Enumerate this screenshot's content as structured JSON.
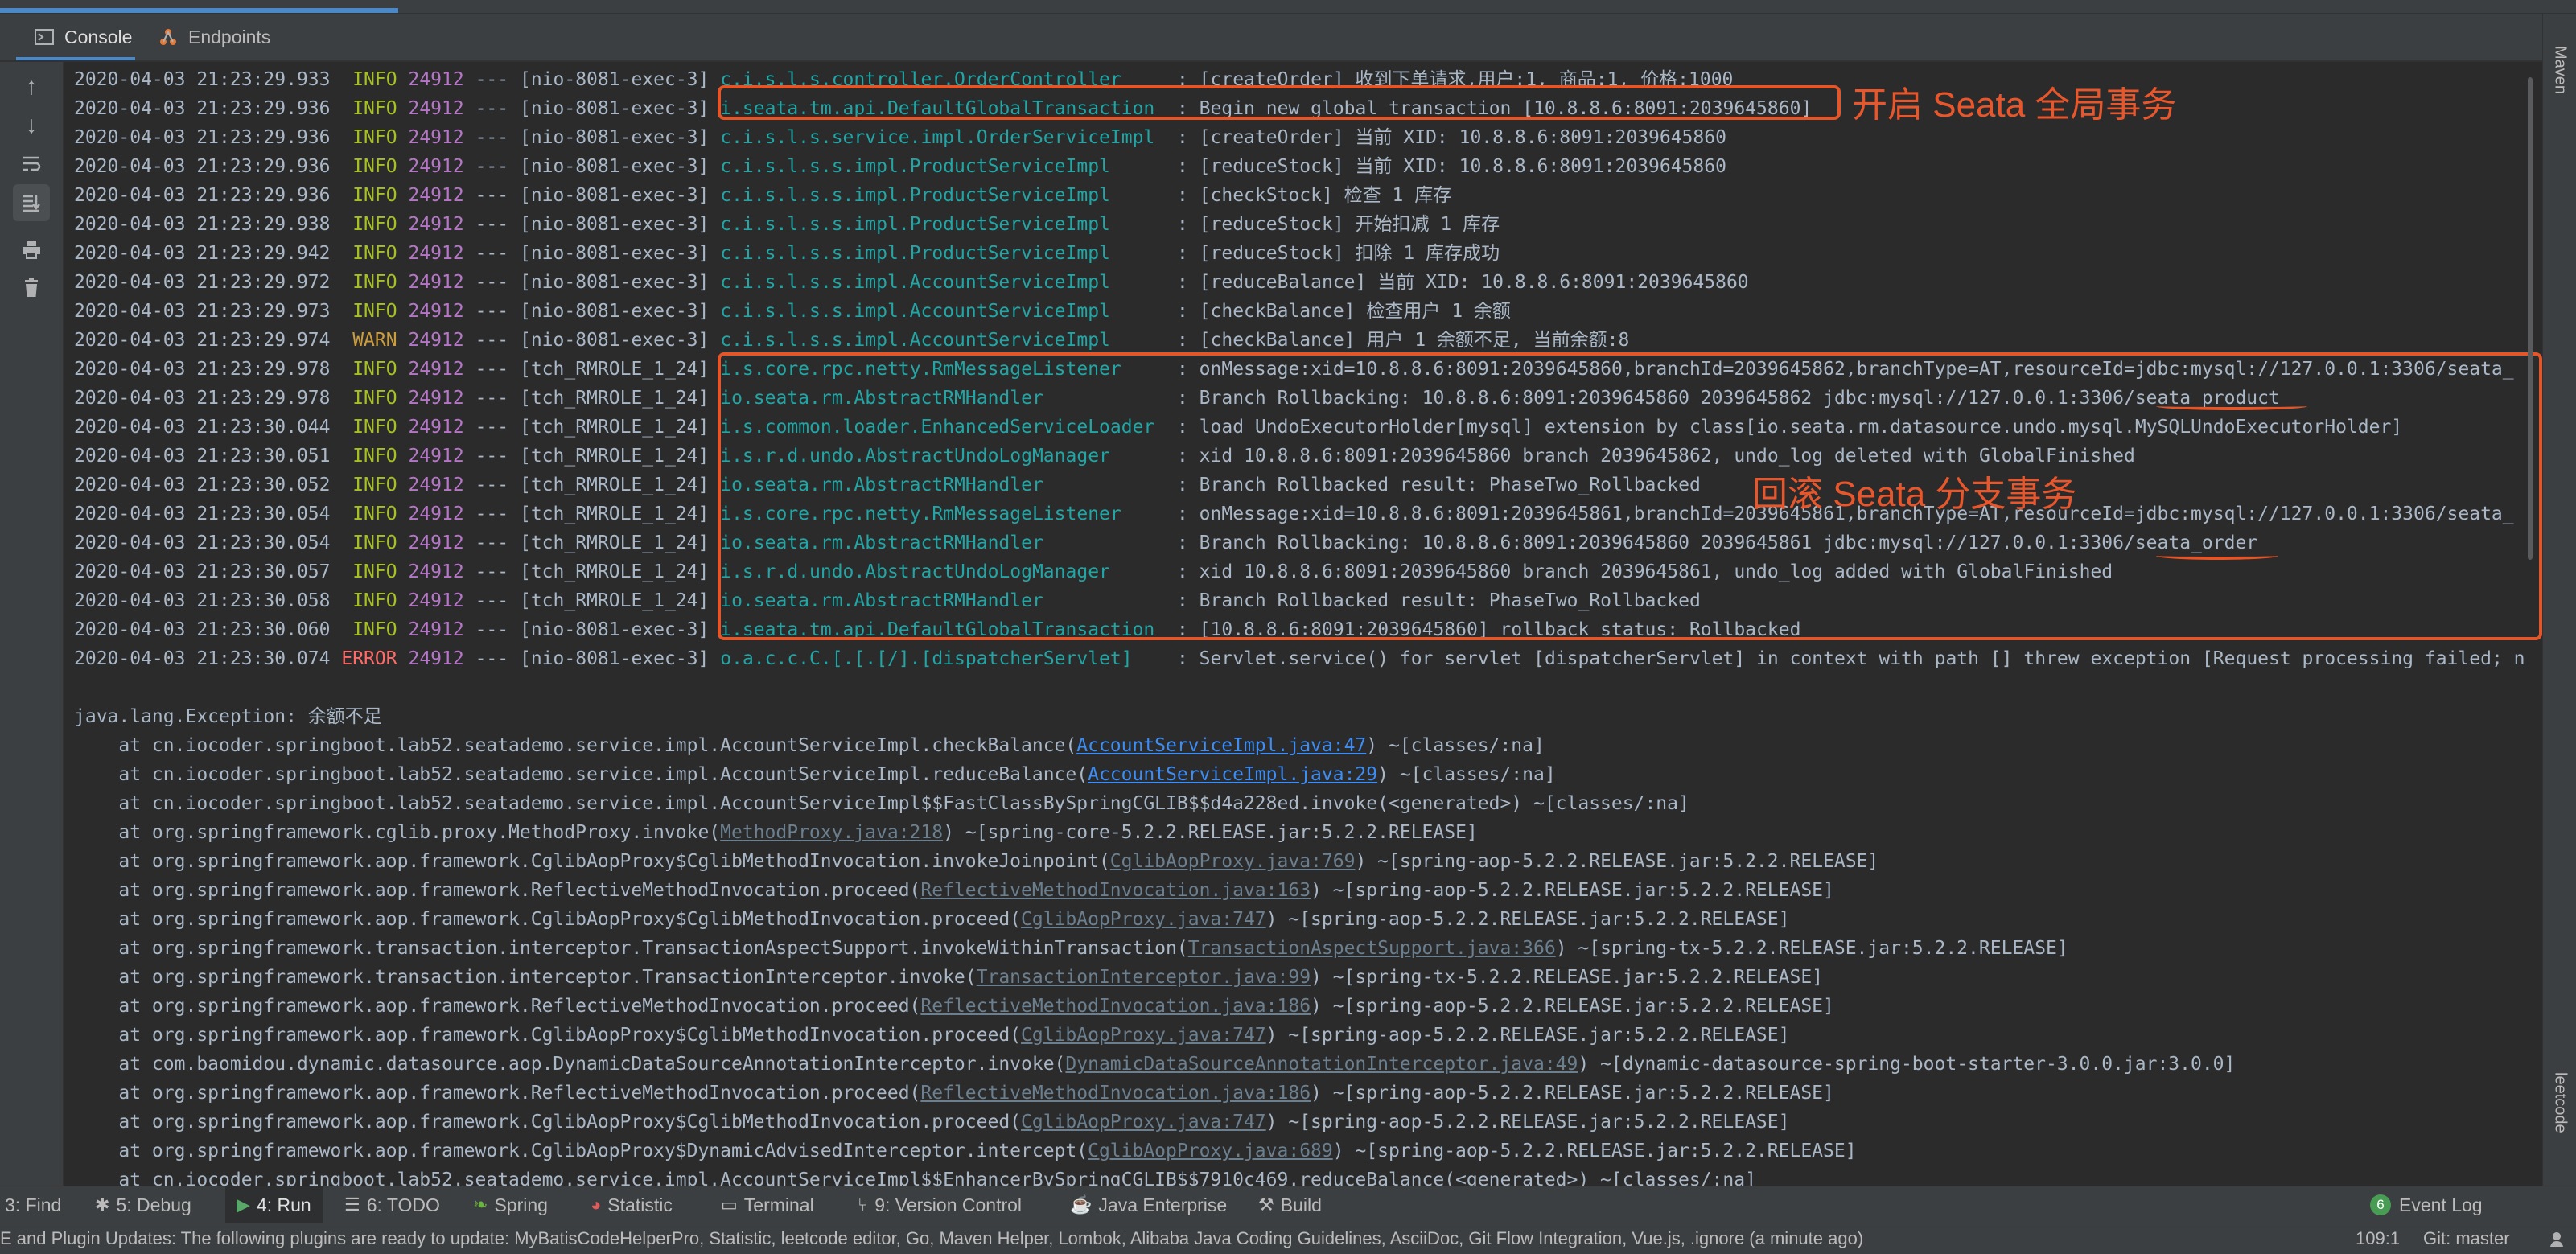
{
  "tabs": [
    {
      "label": "Console",
      "icon": "console-icon"
    },
    {
      "label": "Endpoints",
      "icon": "endpoints-icon"
    }
  ],
  "right_strip": {
    "maven": "Maven",
    "leetcode": "leetcode"
  },
  "log_lines": [
    {
      "time": "2020-04-03 21:23:29.933",
      "level": "INFO",
      "pid": "24912",
      "sep": "---",
      "thread": "[nio-8081-exec-3]",
      "logger": "c.i.s.l.s.controller.OrderController",
      "message": ": [createOrder] 收到下单请求,用户:1, 商品:1, 价格:1000"
    },
    {
      "time": "2020-04-03 21:23:29.936",
      "level": "INFO",
      "pid": "24912",
      "sep": "---",
      "thread": "[nio-8081-exec-3]",
      "logger": "i.seata.tm.api.DefaultGlobalTransaction",
      "message": ": Begin new global transaction [10.8.8.6:8091:2039645860]"
    },
    {
      "time": "2020-04-03 21:23:29.936",
      "level": "INFO",
      "pid": "24912",
      "sep": "---",
      "thread": "[nio-8081-exec-3]",
      "logger": "c.i.s.l.s.service.impl.OrderServiceImpl",
      "message": ": [createOrder] 当前 XID: 10.8.8.6:8091:2039645860"
    },
    {
      "time": "2020-04-03 21:23:29.936",
      "level": "INFO",
      "pid": "24912",
      "sep": "---",
      "thread": "[nio-8081-exec-3]",
      "logger": "c.i.s.l.s.s.impl.ProductServiceImpl",
      "message": ": [reduceStock] 当前 XID: 10.8.8.6:8091:2039645860"
    },
    {
      "time": "2020-04-03 21:23:29.936",
      "level": "INFO",
      "pid": "24912",
      "sep": "---",
      "thread": "[nio-8081-exec-3]",
      "logger": "c.i.s.l.s.s.impl.ProductServiceImpl",
      "message": ": [checkStock] 检查 1 库存"
    },
    {
      "time": "2020-04-03 21:23:29.938",
      "level": "INFO",
      "pid": "24912",
      "sep": "---",
      "thread": "[nio-8081-exec-3]",
      "logger": "c.i.s.l.s.s.impl.ProductServiceImpl",
      "message": ": [reduceStock] 开始扣减 1 库存"
    },
    {
      "time": "2020-04-03 21:23:29.942",
      "level": "INFO",
      "pid": "24912",
      "sep": "---",
      "thread": "[nio-8081-exec-3]",
      "logger": "c.i.s.l.s.s.impl.ProductServiceImpl",
      "message": ": [reduceStock] 扣除 1 库存成功"
    },
    {
      "time": "2020-04-03 21:23:29.972",
      "level": "INFO",
      "pid": "24912",
      "sep": "---",
      "thread": "[nio-8081-exec-3]",
      "logger": "c.i.s.l.s.s.impl.AccountServiceImpl",
      "message": ": [reduceBalance] 当前 XID: 10.8.8.6:8091:2039645860"
    },
    {
      "time": "2020-04-03 21:23:29.973",
      "level": "INFO",
      "pid": "24912",
      "sep": "---",
      "thread": "[nio-8081-exec-3]",
      "logger": "c.i.s.l.s.s.impl.AccountServiceImpl",
      "message": ": [checkBalance] 检查用户 1 余额"
    },
    {
      "time": "2020-04-03 21:23:29.974",
      "level": "WARN",
      "pid": "24912",
      "sep": "---",
      "thread": "[nio-8081-exec-3]",
      "logger": "c.i.s.l.s.s.impl.AccountServiceImpl",
      "message": ": [checkBalance] 用户 1 余额不足, 当前余额:8"
    },
    {
      "time": "2020-04-03 21:23:29.978",
      "level": "INFO",
      "pid": "24912",
      "sep": "---",
      "thread": "[tch_RMROLE_1_24]",
      "logger": "i.s.core.rpc.netty.RmMessageListener",
      "message": ": onMessage:xid=10.8.8.6:8091:2039645860,branchId=2039645862,branchType=AT,resourceId=jdbc:mysql://127.0.0.1:3306/seata_"
    },
    {
      "time": "2020-04-03 21:23:29.978",
      "level": "INFO",
      "pid": "24912",
      "sep": "---",
      "thread": "[tch_RMROLE_1_24]",
      "logger": "io.seata.rm.AbstractRMHandler",
      "message": ": Branch Rollbacking: 10.8.8.6:8091:2039645860 2039645862 jdbc:mysql://127.0.0.1:3306/seata_product"
    },
    {
      "time": "2020-04-03 21:23:30.044",
      "level": "INFO",
      "pid": "24912",
      "sep": "---",
      "thread": "[tch_RMROLE_1_24]",
      "logger": "i.s.common.loader.EnhancedServiceLoader",
      "message": ": load UndoExecutorHolder[mysql] extension by class[io.seata.rm.datasource.undo.mysql.MySQLUndoExecutorHolder]"
    },
    {
      "time": "2020-04-03 21:23:30.051",
      "level": "INFO",
      "pid": "24912",
      "sep": "---",
      "thread": "[tch_RMROLE_1_24]",
      "logger": "i.s.r.d.undo.AbstractUndoLogManager",
      "message": ": xid 10.8.8.6:8091:2039645860 branch 2039645862, undo_log deleted with GlobalFinished"
    },
    {
      "time": "2020-04-03 21:23:30.052",
      "level": "INFO",
      "pid": "24912",
      "sep": "---",
      "thread": "[tch_RMROLE_1_24]",
      "logger": "io.seata.rm.AbstractRMHandler",
      "message": ": Branch Rollbacked result: PhaseTwo_Rollbacked"
    },
    {
      "time": "2020-04-03 21:23:30.054",
      "level": "INFO",
      "pid": "24912",
      "sep": "---",
      "thread": "[tch_RMROLE_1_24]",
      "logger": "i.s.core.rpc.netty.RmMessageListener",
      "message": ": onMessage:xid=10.8.8.6:8091:2039645861,branchId=2039645861,branchType=AT,resourceId=jdbc:mysql://127.0.0.1:3306/seata_"
    },
    {
      "time": "2020-04-03 21:23:30.054",
      "level": "INFO",
      "pid": "24912",
      "sep": "---",
      "thread": "[tch_RMROLE_1_24]",
      "logger": "io.seata.rm.AbstractRMHandler",
      "message": ": Branch Rollbacking: 10.8.8.6:8091:2039645860 2039645861 jdbc:mysql://127.0.0.1:3306/seata_order"
    },
    {
      "time": "2020-04-03 21:23:30.057",
      "level": "INFO",
      "pid": "24912",
      "sep": "---",
      "thread": "[tch_RMROLE_1_24]",
      "logger": "i.s.r.d.undo.AbstractUndoLogManager",
      "message": ": xid 10.8.8.6:8091:2039645860 branch 2039645861, undo_log added with GlobalFinished"
    },
    {
      "time": "2020-04-03 21:23:30.058",
      "level": "INFO",
      "pid": "24912",
      "sep": "---",
      "thread": "[tch_RMROLE_1_24]",
      "logger": "io.seata.rm.AbstractRMHandler",
      "message": ": Branch Rollbacked result: PhaseTwo_Rollbacked"
    },
    {
      "time": "2020-04-03 21:23:30.060",
      "level": "INFO",
      "pid": "24912",
      "sep": "---",
      "thread": "[nio-8081-exec-3]",
      "logger": "i.seata.tm.api.DefaultGlobalTransaction",
      "message": ": [10.8.8.6:8091:2039645860] rollback status: Rollbacked"
    },
    {
      "time": "2020-04-03 21:23:30.074",
      "level": "ERROR",
      "pid": "24912",
      "sep": "---",
      "thread": "[nio-8081-exec-3]",
      "logger": "o.a.c.c.C.[.[.[/].[dispatcherServlet]",
      "message": ": Servlet.service() for servlet [dispatcherServlet] in context with path [] threw exception [Request processing failed; n"
    }
  ],
  "exception_header": "java.lang.Exception: 余额不足",
  "stack_lines": [
    {
      "pre": "    at cn.iocoder.springboot.lab52.seatademo.service.impl.AccountServiceImpl.checkBalance(",
      "link": "AccountServiceImpl.java:47",
      "post": ") ~[classes/:na]",
      "style": "blue"
    },
    {
      "pre": "    at cn.iocoder.springboot.lab52.seatademo.service.impl.AccountServiceImpl.reduceBalance(",
      "link": "AccountServiceImpl.java:29",
      "post": ") ~[classes/:na]",
      "style": "blue"
    },
    {
      "pre": "    at cn.iocoder.springboot.lab52.seatademo.service.impl.AccountServiceImpl$$FastClassBySpringCGLIB$$d4a228ed.invoke(<generated>) ~[classes/:na]",
      "link": "",
      "post": "",
      "style": "none"
    },
    {
      "pre": "    at org.springframework.cglib.proxy.MethodProxy.invoke(",
      "link": "MethodProxy.java:218",
      "post": ") ~[spring-core-5.2.2.RELEASE.jar:5.2.2.RELEASE]",
      "style": "gray"
    },
    {
      "pre": "    at org.springframework.aop.framework.CglibAopProxy$CglibMethodInvocation.invokeJoinpoint(",
      "link": "CglibAopProxy.java:769",
      "post": ") ~[spring-aop-5.2.2.RELEASE.jar:5.2.2.RELEASE]",
      "style": "gray"
    },
    {
      "pre": "    at org.springframework.aop.framework.ReflectiveMethodInvocation.proceed(",
      "link": "ReflectiveMethodInvocation.java:163",
      "post": ") ~[spring-aop-5.2.2.RELEASE.jar:5.2.2.RELEASE]",
      "style": "gray"
    },
    {
      "pre": "    at org.springframework.aop.framework.CglibAopProxy$CglibMethodInvocation.proceed(",
      "link": "CglibAopProxy.java:747",
      "post": ") ~[spring-aop-5.2.2.RELEASE.jar:5.2.2.RELEASE]",
      "style": "gray"
    },
    {
      "pre": "    at org.springframework.transaction.interceptor.TransactionAspectSupport.invokeWithinTransaction(",
      "link": "TransactionAspectSupport.java:366",
      "post": ") ~[spring-tx-5.2.2.RELEASE.jar:5.2.2.RELEASE]",
      "style": "gray"
    },
    {
      "pre": "    at org.springframework.transaction.interceptor.TransactionInterceptor.invoke(",
      "link": "TransactionInterceptor.java:99",
      "post": ") ~[spring-tx-5.2.2.RELEASE.jar:5.2.2.RELEASE]",
      "style": "gray"
    },
    {
      "pre": "    at org.springframework.aop.framework.ReflectiveMethodInvocation.proceed(",
      "link": "ReflectiveMethodInvocation.java:186",
      "post": ") ~[spring-aop-5.2.2.RELEASE.jar:5.2.2.RELEASE]",
      "style": "gray"
    },
    {
      "pre": "    at org.springframework.aop.framework.CglibAopProxy$CglibMethodInvocation.proceed(",
      "link": "CglibAopProxy.java:747",
      "post": ") ~[spring-aop-5.2.2.RELEASE.jar:5.2.2.RELEASE]",
      "style": "gray"
    },
    {
      "pre": "    at com.baomidou.dynamic.datasource.aop.DynamicDataSourceAnnotationInterceptor.invoke(",
      "link": "DynamicDataSourceAnnotationInterceptor.java:49",
      "post": ") ~[dynamic-datasource-spring-boot-starter-3.0.0.jar:3.0.0]",
      "style": "gray"
    },
    {
      "pre": "    at org.springframework.aop.framework.ReflectiveMethodInvocation.proceed(",
      "link": "ReflectiveMethodInvocation.java:186",
      "post": ") ~[spring-aop-5.2.2.RELEASE.jar:5.2.2.RELEASE]",
      "style": "gray"
    },
    {
      "pre": "    at org.springframework.aop.framework.CglibAopProxy$CglibMethodInvocation.proceed(",
      "link": "CglibAopProxy.java:747",
      "post": ") ~[spring-aop-5.2.2.RELEASE.jar:5.2.2.RELEASE]",
      "style": "gray"
    },
    {
      "pre": "    at org.springframework.aop.framework.CglibAopProxy$DynamicAdvisedInterceptor.intercept(",
      "link": "CglibAopProxy.java:689",
      "post": ") ~[spring-aop-5.2.2.RELEASE.jar:5.2.2.RELEASE]",
      "style": "gray"
    },
    {
      "pre": "    at cn.iocoder.springboot.lab52.seatademo.service.impl.AccountServiceImpl$$EnhancerBySpringCGLIB$$7910c469.reduceBalance(<generated>) ~[classes/:na]",
      "link": "",
      "post": "",
      "style": "none"
    }
  ],
  "annotations": {
    "begin_global": "开启 Seata 全局事务",
    "rollback_branch": "回滚 Seata 分支事务"
  },
  "bottom_tools": [
    {
      "label": "3: Find",
      "icon": "find-icon"
    },
    {
      "label": "5: Debug",
      "icon": "debug-icon"
    },
    {
      "label": "4: Run",
      "icon": "run-icon"
    },
    {
      "label": "6: TODO",
      "icon": "todo-icon"
    },
    {
      "label": "Spring",
      "icon": "spring-icon"
    },
    {
      "label": "Statistic",
      "icon": "statistic-icon"
    },
    {
      "label": "Terminal",
      "icon": "terminal-icon"
    },
    {
      "label": "9: Version Control",
      "icon": "version-control-icon"
    },
    {
      "label": "Java Enterprise",
      "icon": "java-enterprise-icon"
    },
    {
      "label": "Build",
      "icon": "build-icon"
    }
  ],
  "event_log": {
    "label": "Event Log",
    "count": "6"
  },
  "status": {
    "message": "E and Plugin Updates: The following plugins are ready to update: MyBatisCodeHelperPro, Statistic, leetcode editor, Go, Maven Helper, Lombok, Alibaba Java Coding Guidelines, AsciiDoc, Git Flow Integration, Vue.js, .ignore (a minute ago)",
    "position": "109:1",
    "git": "Git: master"
  },
  "colors": {
    "annotation": "#e2562a",
    "info": "#a8c023",
    "warn": "#cc9d3a",
    "error": "#ff6b68",
    "logger": "#22a5a5",
    "pid": "#b676c8"
  }
}
